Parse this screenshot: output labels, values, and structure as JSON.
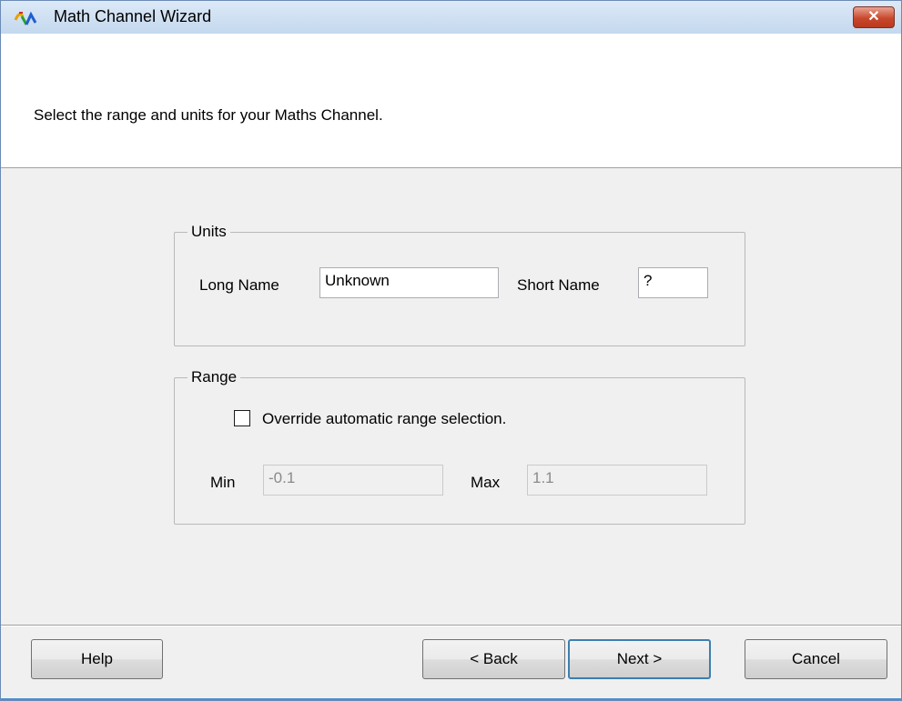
{
  "window": {
    "title": "Math Channel Wizard",
    "close_label": "✕"
  },
  "header": {
    "instruction": "Select the range and units for your Maths Channel."
  },
  "units": {
    "legend": "Units",
    "long_name_label": "Long Name",
    "long_name_value": "Unknown",
    "short_name_label": "Short Name",
    "short_name_value": "?"
  },
  "range": {
    "legend": "Range",
    "override_label": "Override automatic range selection.",
    "override_checked": false,
    "min_label": "Min",
    "min_value": "-0.1",
    "max_label": "Max",
    "max_value": "1.1"
  },
  "buttons": {
    "help": "Help",
    "back": "< Back",
    "next": "Next >",
    "cancel": "Cancel"
  }
}
